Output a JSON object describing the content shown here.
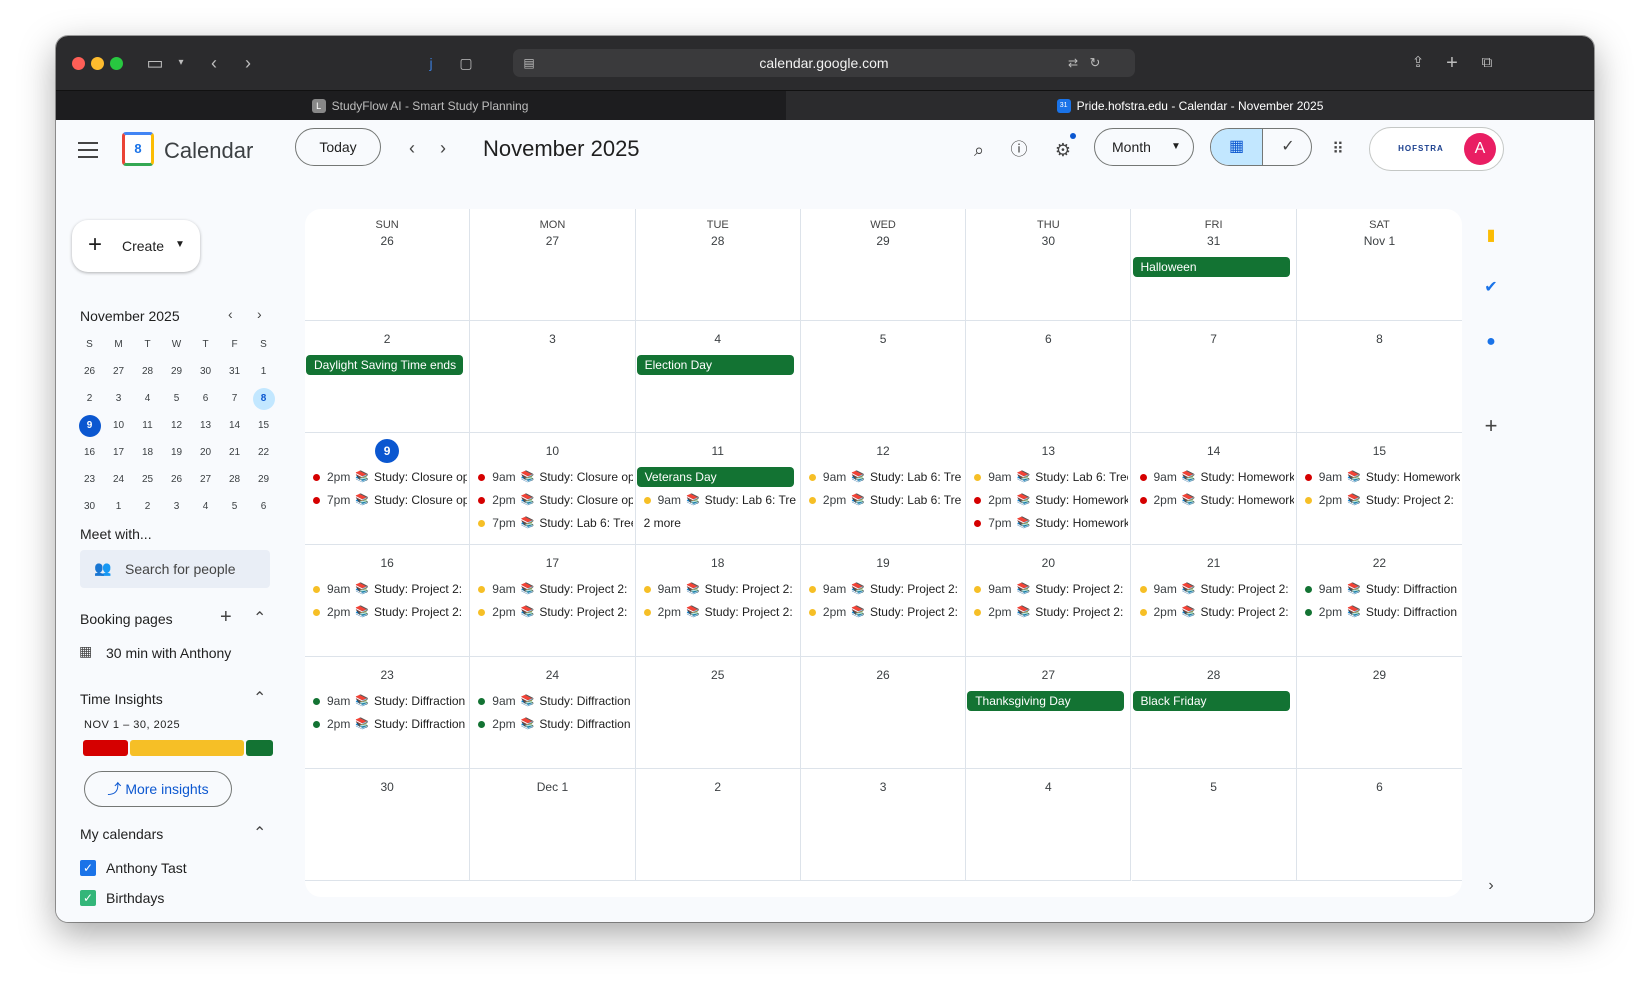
{
  "browser": {
    "url": "calendar.google.com",
    "tabs": [
      {
        "label": "StudyFlow AI - Smart Study Planning",
        "favicon": "L"
      },
      {
        "label": "Pride.hofstra.edu - Calendar - November 2025",
        "favicon": "31"
      }
    ]
  },
  "header": {
    "app_name": "Calendar",
    "logo_num": "8",
    "today_label": "Today",
    "month_title": "November 2025",
    "view_label": "Month",
    "avatar_letter": "A",
    "org_logo_text": "HOFSTRA"
  },
  "sidebar": {
    "create_label": "Create",
    "mini_title": "November 2025",
    "weekday_initials": [
      "S",
      "M",
      "T",
      "W",
      "T",
      "F",
      "S"
    ],
    "mini_weeks": [
      [
        "26",
        "27",
        "28",
        "29",
        "30",
        "31",
        "1"
      ],
      [
        "2",
        "3",
        "4",
        "5",
        "6",
        "7",
        "8"
      ],
      [
        "9",
        "10",
        "11",
        "12",
        "13",
        "14",
        "15"
      ],
      [
        "16",
        "17",
        "18",
        "19",
        "20",
        "21",
        "22"
      ],
      [
        "23",
        "24",
        "25",
        "26",
        "27",
        "28",
        "29"
      ],
      [
        "30",
        "1",
        "2",
        "3",
        "4",
        "5",
        "6"
      ]
    ],
    "meet_with": "Meet with...",
    "search_people": "Search for people",
    "booking_pages": "Booking pages",
    "booking_item": "30 min with Anthony",
    "time_insights": "Time Insights",
    "insights_range": "NOV 1 – 30, 2025",
    "insight_colors": [
      "#d50000",
      "#f6bf26",
      "#137333"
    ],
    "more_insights": "More insights",
    "my_calendars": "My calendars",
    "calendars": [
      {
        "name": "Anthony Tast",
        "color": "#1a73e8"
      },
      {
        "name": "Birthdays",
        "color": "#33b679"
      }
    ]
  },
  "colors": {
    "red": "#d50000",
    "yellow": "#f6bf26",
    "green": "#137333",
    "accent": "#0b57d0"
  },
  "grid": {
    "weekdays": [
      "SUN",
      "MON",
      "TUE",
      "WED",
      "THU",
      "FRI",
      "SAT"
    ],
    "weeks": [
      [
        {
          "day": "26"
        },
        {
          "day": "27"
        },
        {
          "day": "28"
        },
        {
          "day": "29"
        },
        {
          "day": "30"
        },
        {
          "day": "31",
          "allday": "Halloween"
        },
        {
          "day": "Nov 1"
        }
      ],
      [
        {
          "day": "2",
          "allday": "Daylight Saving Time ends"
        },
        {
          "day": "3"
        },
        {
          "day": "4",
          "allday": "Election Day"
        },
        {
          "day": "5"
        },
        {
          "day": "6"
        },
        {
          "day": "7"
        },
        {
          "day": "8"
        }
      ],
      [
        {
          "day": "9",
          "today": true,
          "events": [
            {
              "c": "red",
              "t": "2pm",
              "title": "Study: Closure op"
            },
            {
              "c": "red",
              "t": "7pm",
              "title": "Study: Closure op"
            }
          ]
        },
        {
          "day": "10",
          "events": [
            {
              "c": "red",
              "t": "9am",
              "title": "Study: Closure op"
            },
            {
              "c": "red",
              "t": "2pm",
              "title": "Study: Closure op"
            },
            {
              "c": "yellow",
              "t": "7pm",
              "title": "Study: Lab 6: Tree"
            }
          ]
        },
        {
          "day": "11",
          "allday": "Veterans Day",
          "events": [
            {
              "c": "yellow",
              "t": "9am",
              "title": "Study: Lab 6: Tre"
            }
          ],
          "more": "2 more"
        },
        {
          "day": "12",
          "events": [
            {
              "c": "yellow",
              "t": "9am",
              "title": "Study: Lab 6: Tre"
            },
            {
              "c": "yellow",
              "t": "2pm",
              "title": "Study: Lab 6: Tre"
            }
          ]
        },
        {
          "day": "13",
          "events": [
            {
              "c": "yellow",
              "t": "9am",
              "title": "Study: Lab 6: Tree"
            },
            {
              "c": "red",
              "t": "2pm",
              "title": "Study: Homework"
            },
            {
              "c": "red",
              "t": "7pm",
              "title": "Study: Homework"
            }
          ]
        },
        {
          "day": "14",
          "events": [
            {
              "c": "red",
              "t": "9am",
              "title": "Study: Homework"
            },
            {
              "c": "red",
              "t": "2pm",
              "title": "Study: Homework"
            }
          ]
        },
        {
          "day": "15",
          "events": [
            {
              "c": "red",
              "t": "9am",
              "title": "Study: Homework"
            },
            {
              "c": "yellow",
              "t": "2pm",
              "title": "Study: Project 2:"
            }
          ]
        }
      ],
      [
        {
          "day": "16",
          "events": [
            {
              "c": "yellow",
              "t": "9am",
              "title": "Study: Project 2:"
            },
            {
              "c": "yellow",
              "t": "2pm",
              "title": "Study: Project 2:"
            }
          ]
        },
        {
          "day": "17",
          "events": [
            {
              "c": "yellow",
              "t": "9am",
              "title": "Study: Project 2:"
            },
            {
              "c": "yellow",
              "t": "2pm",
              "title": "Study: Project 2:"
            }
          ]
        },
        {
          "day": "18",
          "events": [
            {
              "c": "yellow",
              "t": "9am",
              "title": "Study: Project 2:"
            },
            {
              "c": "yellow",
              "t": "2pm",
              "title": "Study: Project 2:"
            }
          ]
        },
        {
          "day": "19",
          "events": [
            {
              "c": "yellow",
              "t": "9am",
              "title": "Study: Project 2:"
            },
            {
              "c": "yellow",
              "t": "2pm",
              "title": "Study: Project 2:"
            }
          ]
        },
        {
          "day": "20",
          "events": [
            {
              "c": "yellow",
              "t": "9am",
              "title": "Study: Project 2:"
            },
            {
              "c": "yellow",
              "t": "2pm",
              "title": "Study: Project 2:"
            }
          ]
        },
        {
          "day": "21",
          "events": [
            {
              "c": "yellow",
              "t": "9am",
              "title": "Study: Project 2:"
            },
            {
              "c": "yellow",
              "t": "2pm",
              "title": "Study: Project 2:"
            }
          ]
        },
        {
          "day": "22",
          "events": [
            {
              "c": "green",
              "t": "9am",
              "title": "Study: Diffraction"
            },
            {
              "c": "green",
              "t": "2pm",
              "title": "Study: Diffraction"
            }
          ]
        }
      ],
      [
        {
          "day": "23",
          "events": [
            {
              "c": "green",
              "t": "9am",
              "title": "Study: Diffraction"
            },
            {
              "c": "green",
              "t": "2pm",
              "title": "Study: Diffraction"
            }
          ]
        },
        {
          "day": "24",
          "events": [
            {
              "c": "green",
              "t": "9am",
              "title": "Study: Diffraction"
            },
            {
              "c": "green",
              "t": "2pm",
              "title": "Study: Diffraction"
            }
          ]
        },
        {
          "day": "25"
        },
        {
          "day": "26"
        },
        {
          "day": "27",
          "allday": "Thanksgiving Day"
        },
        {
          "day": "28",
          "allday": "Black Friday"
        },
        {
          "day": "29"
        }
      ],
      [
        {
          "day": "30"
        },
        {
          "day": "Dec 1"
        },
        {
          "day": "2"
        },
        {
          "day": "3"
        },
        {
          "day": "4"
        },
        {
          "day": "5"
        },
        {
          "day": "6"
        }
      ]
    ]
  }
}
